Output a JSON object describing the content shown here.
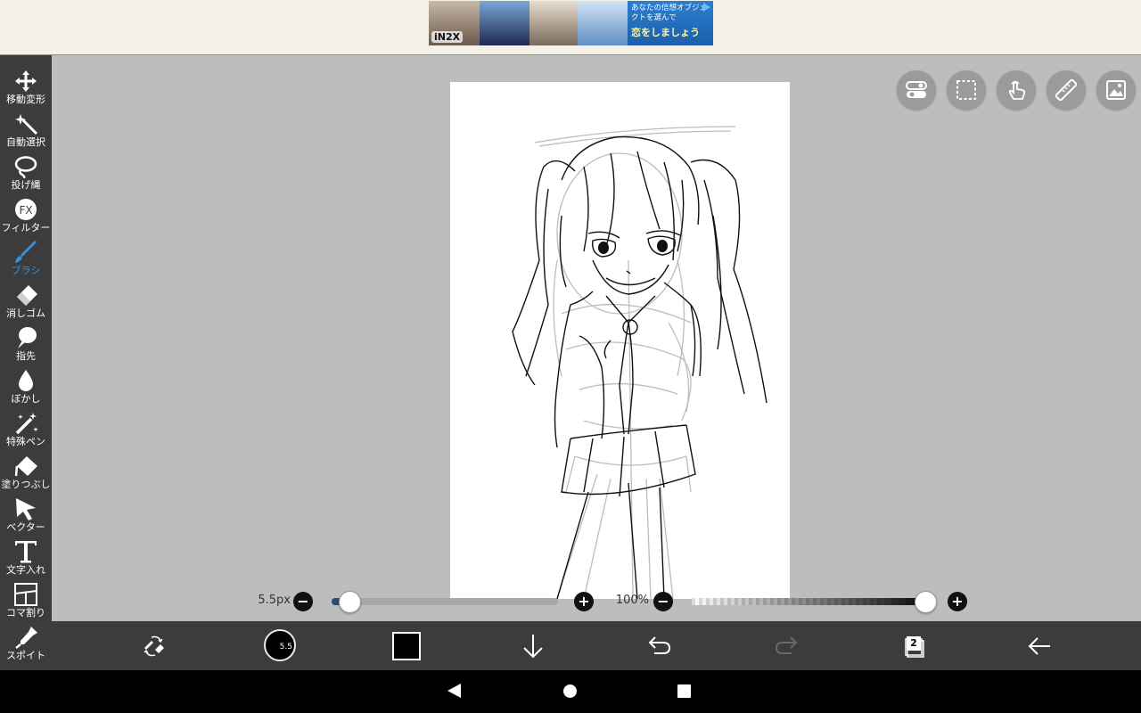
{
  "ad": {
    "logo": "iN2X",
    "text_line1": "あなたの信想オブジェクトを選んで",
    "text_line2": "恋をしましょう",
    "panel_colors": [
      "#6b5a4e",
      "#1f2a4e",
      "#7a6a5a",
      "#5e8fc6"
    ]
  },
  "toolbar": {
    "items": [
      {
        "label": "移動変形",
        "icon": "move-icon"
      },
      {
        "label": "自動選択",
        "icon": "magic-wand-icon"
      },
      {
        "label": "投げ縄",
        "icon": "lasso-icon"
      },
      {
        "label": "フィルター",
        "icon": "fx-icon"
      },
      {
        "label": "ブラシ",
        "icon": "brush-icon",
        "active": true
      },
      {
        "label": "消しゴム",
        "icon": "eraser-icon"
      },
      {
        "label": "指先",
        "icon": "smudge-icon"
      },
      {
        "label": "ぼかし",
        "icon": "blur-drop-icon"
      },
      {
        "label": "特殊ペン",
        "icon": "special-pen-icon"
      },
      {
        "label": "塗りつぶし",
        "icon": "fill-bucket-icon"
      },
      {
        "label": "ベクター",
        "icon": "vector-arrow-icon"
      },
      {
        "label": "文字入れ",
        "icon": "text-icon"
      },
      {
        "label": "コマ割り",
        "icon": "frame-divider-icon"
      },
      {
        "label": "スポイト",
        "icon": "eyedropper-icon"
      }
    ],
    "active_color": "#3a8ee0"
  },
  "top_right_buttons": [
    "toggle-settings-icon",
    "selection-icon",
    "hand-gesture-icon",
    "ruler-icon",
    "image-icon"
  ],
  "sliders": {
    "brush_size": "5.5px",
    "brush_size_fraction": 0.06,
    "minus": "−",
    "plus": "+",
    "opacity": "100%",
    "opacity_fraction": 1.0
  },
  "bottom_bar": {
    "brush_size_label": "5.5",
    "current_color": "#000000",
    "layer_count": "2",
    "icons": [
      "swap-tools-icon",
      "brush-size-icon",
      "color-swatch",
      "download-arrow-icon",
      "undo-icon",
      "redo-icon",
      "layers-icon",
      "back-arrow-icon"
    ]
  },
  "nav": {
    "icons": [
      "nav-back-icon",
      "nav-home-icon",
      "nav-recent-icon"
    ]
  }
}
